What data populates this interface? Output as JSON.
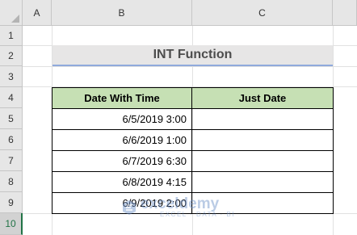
{
  "columns": [
    "A",
    "B",
    "C"
  ],
  "rows": [
    "1",
    "2",
    "3",
    "4",
    "5",
    "6",
    "7",
    "8",
    "9",
    "10"
  ],
  "title": "INT Function",
  "table": {
    "headers": [
      "Date With Time",
      "Just Date"
    ],
    "rows": [
      [
        "6/5/2019 3:00",
        ""
      ],
      [
        "6/6/2019 1:00",
        ""
      ],
      [
        "6/7/2019 6:30",
        ""
      ],
      [
        "6/8/2019 4:15",
        ""
      ],
      [
        "6/9/2019 2:00",
        ""
      ]
    ]
  },
  "watermark": {
    "name": "exceldemy",
    "tagline": "EXCEL · DATA · BI"
  },
  "colors": {
    "header_fill": "#c6e0b4",
    "title_fill": "#e7e6e6",
    "title_underline": "#8faadc",
    "active_row_accent": "#217346"
  }
}
